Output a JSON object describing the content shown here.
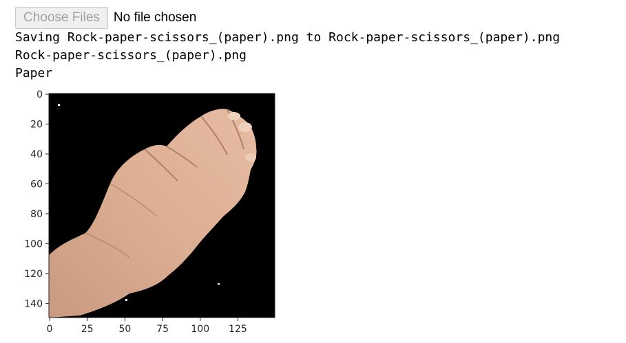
{
  "file_input": {
    "button_label": "Choose Files",
    "status_text": "No file chosen"
  },
  "output": {
    "line1": "Saving Rock-paper-scissors_(paper).png to Rock-paper-scissors_(paper).png",
    "line2": "Rock-paper-scissors_(paper).png",
    "line3": "Paper"
  },
  "chart_data": {
    "type": "image",
    "x_ticks": [
      0,
      25,
      50,
      75,
      100,
      125
    ],
    "y_ticks": [
      0,
      20,
      40,
      60,
      80,
      100,
      120,
      140
    ],
    "xlim": [
      -0.5,
      149.5
    ],
    "ylim": [
      149.5,
      -0.5
    ],
    "grid": false
  },
  "colors": {
    "image_background": "#000000",
    "skin": "#d9a88c",
    "skin_shadow": "#b7846a",
    "axis": "#262626"
  }
}
